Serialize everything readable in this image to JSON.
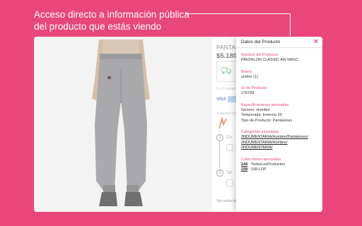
{
  "headline": {
    "line1": "Acceso directo a información pública",
    "line2": "del producto que estás viendo"
  },
  "product_page": {
    "title": "PANTALON",
    "price": "$5.180",
    "installments": "3 y 6 cuotas",
    "payment_visa": "VISA",
    "stock_note": "3 quedan en...",
    "step1_label": "Co",
    "step2_label": "Tal",
    "size_guide": "Ver tabla de"
  },
  "panel": {
    "title": "Datos del Producto",
    "close_symbol": "×",
    "name": {
      "label": "Nombre del Producto",
      "value": "PANTALON CLASSIC AW MASC"
    },
    "brand": {
      "label": "Brand",
      "value": "umbro (1)"
    },
    "id": {
      "label": "ID de Producto",
      "value": "276799"
    },
    "specs": {
      "label": "Especificaciones asociadas",
      "items": [
        "Género: Hombre",
        "Temporada: Invierno 20",
        "Tipo de Producto: Pantalones"
      ]
    },
    "categories": {
      "label": "Categorías asociadas",
      "items": [
        "/INDUMENTARIA/Hombre/Pantalones/",
        "/INDUMENTARIA/Hombre/",
        "/INDUMENTARIA/"
      ]
    },
    "collections": {
      "label": "Colecciones asociadas",
      "items": [
        {
          "id": "144",
          "name": "TodosLosProductos"
        },
        {
          "id": "158",
          "name": "158-LDP"
        }
      ]
    }
  },
  "colors": {
    "accent": "#e8477a",
    "card": "#ffffff",
    "photo_bg": "#f3f3f3"
  }
}
